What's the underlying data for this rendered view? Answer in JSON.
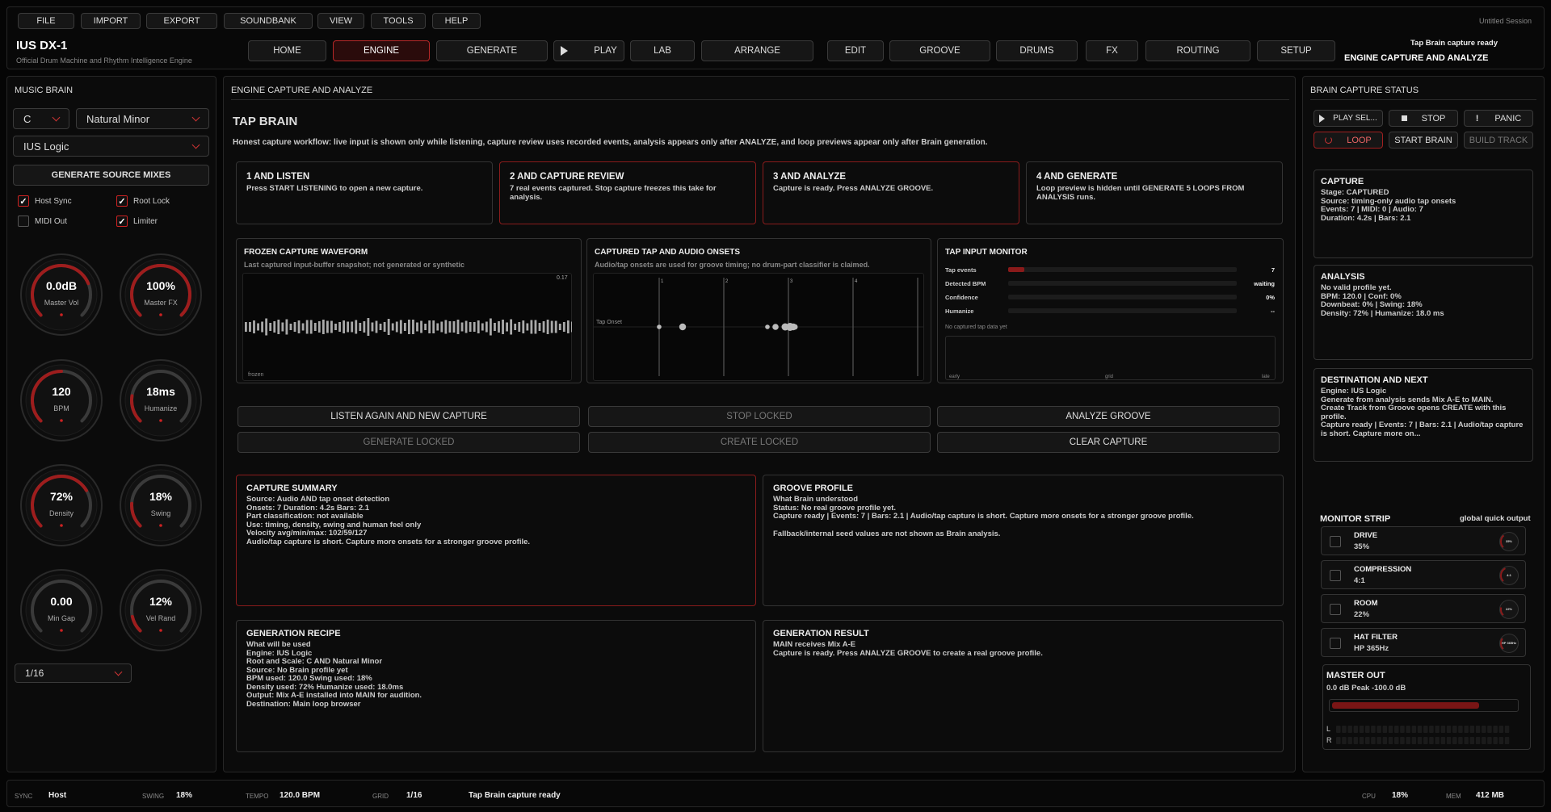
{
  "menu": [
    "FILE",
    "IMPORT",
    "EXPORT",
    "SOUNDBANK",
    "VIEW",
    "TOOLS",
    "HELP"
  ],
  "session": "Untitled Session",
  "app": {
    "title": "IUS DX-1",
    "subtitle": "Official Drum Machine and Rhythm Intelligence Engine"
  },
  "nav": [
    "HOME",
    "ENGINE",
    "GENERATE",
    "PLAY",
    "LAB",
    "ARRANGE",
    "EDIT",
    "GROOVE",
    "DRUMS",
    "FX",
    "ROUTING",
    "SETUP"
  ],
  "header": {
    "status": "Tap Brain capture ready",
    "mode": "ENGINE CAPTURE AND ANALYZE"
  },
  "left": {
    "title": "MUSIC BRAIN",
    "key": "C",
    "scale": "Natural Minor",
    "logic": "IUS Logic",
    "gen_btn": "GENERATE SOURCE MIXES",
    "checks": [
      {
        "label": "Host Sync",
        "on": true
      },
      {
        "label": "Root Lock",
        "on": true
      },
      {
        "label": "MIDI Out",
        "on": false
      },
      {
        "label": "Limiter",
        "on": true
      }
    ],
    "knobs": [
      {
        "value": "0.0dB",
        "label": "Master Vol",
        "level": 0.75
      },
      {
        "value": "100%",
        "label": "Master FX",
        "level": 1.0
      },
      {
        "value": "120",
        "label": "BPM",
        "level": 0.5
      },
      {
        "value": "18ms",
        "label": "Humanize",
        "level": 0.2
      },
      {
        "value": "72%",
        "label": "Density",
        "level": 0.72
      },
      {
        "value": "18%",
        "label": "Swing",
        "level": 0.18
      },
      {
        "value": "0.00",
        "label": "Min Gap",
        "level": 0.0
      },
      {
        "value": "12%",
        "label": "Vel Rand",
        "level": 0.12
      }
    ],
    "grid": "1/16"
  },
  "center": {
    "title": "ENGINE CAPTURE AND ANALYZE",
    "section": "TAP BRAIN",
    "workflow": "Honest capture workflow: live input is shown only while listening, capture review uses recorded events, analysis appears only after ANALYZE, and loop previews appear only after Brain generation.",
    "steps": [
      {
        "title": "1 AND LISTEN",
        "text": "Press START LISTENING to open a new capture."
      },
      {
        "title": "2 AND CAPTURE REVIEW",
        "text": "7 real events captured. Stop capture freezes this take for analysis."
      },
      {
        "title": "3 AND ANALYZE",
        "text": "Capture is ready. Press ANALYZE GROOVE."
      },
      {
        "title": "4 AND GENERATE",
        "text": "Loop preview is hidden until GENERATE 5 LOOPS FROM ANALYSIS runs."
      }
    ],
    "waveform": {
      "title": "FROZEN CAPTURE WAVEFORM",
      "sub": "Last captured input-buffer snapshot; not generated or synthetic",
      "peak": "0.17",
      "tag": "frozen"
    },
    "onsets": {
      "title": "CAPTURED TAP AND AUDIO ONSETS",
      "sub": "Audio/tap onsets are used for groove timing; no drum-part classifier is claimed.",
      "lane": "Tap Onset",
      "beats": [
        "1",
        "2",
        "3",
        "4"
      ]
    },
    "monitor": {
      "title": "TAP INPUT MONITOR",
      "rows": [
        {
          "label": "Tap events",
          "value": "7",
          "level": 0.07
        },
        {
          "label": "Detected BPM",
          "value": "waiting",
          "level": 0
        },
        {
          "label": "Confidence",
          "value": "0%",
          "level": 0
        },
        {
          "label": "Humanize",
          "value": "--",
          "level": 0
        }
      ],
      "empty": "No captured tap data yet",
      "axis": [
        "early",
        "grid",
        "late"
      ]
    },
    "actions": [
      "LISTEN AGAIN AND NEW CAPTURE",
      "STOP LOCKED",
      "ANALYZE GROOVE",
      "GENERATE LOCKED",
      "CREATE LOCKED",
      "CLEAR CAPTURE"
    ],
    "summary": {
      "title": "CAPTURE SUMMARY",
      "lines": [
        "Source: Audio AND tap onset detection",
        "Onsets: 7    Duration: 4.2s    Bars: 2.1",
        "Part classification: not available",
        "Use: timing, density, swing and human feel only",
        "Velocity avg/min/max: 102/59/127",
        "Audio/tap capture is short. Capture more onsets for a stronger groove profile."
      ]
    },
    "groove": {
      "title": "GROOVE PROFILE",
      "lines": [
        "What Brain understood",
        "Status: No real groove profile yet.",
        "Capture ready | Events: 7 | Bars: 2.1 | Audio/tap capture is short. Capture more onsets for a stronger groove profile.",
        "",
        "Fallback/internal seed values are not shown as Brain analysis."
      ]
    },
    "recipe": {
      "title": "GENERATION RECIPE",
      "lines": [
        "What will be used",
        "Engine: IUS Logic",
        "Root and Scale: C AND Natural Minor",
        "Source: No Brain profile yet",
        "BPM used: 120.0    Swing used: 18%",
        "Density used: 72%    Humanize used: 18.0ms",
        "Output: Mix A-E installed into MAIN for audition.",
        "Destination: Main loop browser"
      ]
    },
    "result": {
      "title": "GENERATION RESULT",
      "lines": [
        "MAIN receives Mix A-E",
        "Capture is ready. Press ANALYZE GROOVE to create a real groove profile."
      ]
    }
  },
  "right": {
    "title": "BRAIN CAPTURE STATUS",
    "transport": [
      "PLAY SEL...",
      "STOP",
      "PANIC",
      "LOOP",
      "START BRAIN",
      "BUILD TRACK"
    ],
    "capture": {
      "title": "CAPTURE",
      "lines": [
        "Stage: CAPTURED",
        "Source: timing-only audio tap onsets",
        "Events: 7 | MIDI: 0 | Audio: 7",
        "Duration: 4.2s | Bars: 2.1"
      ]
    },
    "analysis": {
      "title": "ANALYSIS",
      "lines": [
        "No valid profile yet.",
        "BPM: 120.0 | Conf: 0%",
        "Downbeat: 0% | Swing: 18%",
        "Density: 72% | Humanize: 18.0 ms"
      ]
    },
    "dest": {
      "title": "DESTINATION AND NEXT",
      "lines": [
        "Engine: IUS Logic",
        "Generate from analysis sends Mix A-E to MAIN.",
        "Create Track from Groove opens CREATE with this profile.",
        "Capture ready | Events: 7 | Bars: 2.1 | Audio/tap capture is short. Capture more on..."
      ]
    },
    "strip": {
      "title": "MONITOR STRIP",
      "sub": "global quick output",
      "rows": [
        {
          "name": "DRIVE",
          "value": "35%",
          "knob": "35%",
          "level": 0.35
        },
        {
          "name": "COMPRESSION",
          "value": "4:1",
          "knob": "4:1",
          "level": 0.4
        },
        {
          "name": "ROOM",
          "value": "22%",
          "knob": "22%",
          "level": 0.22
        },
        {
          "name": "HAT FILTER",
          "value": "HP 365Hz",
          "knob": "HP 365Hz",
          "level": 0.3
        }
      ]
    },
    "master": {
      "title": "MASTER OUT",
      "line": "0.0 dB   Peak -100.0 dB",
      "level": 0.8,
      "ch": [
        "L",
        "R"
      ]
    }
  },
  "status": [
    {
      "k": "SYNC",
      "v": "Host"
    },
    {
      "k": "SWING",
      "v": "18%"
    },
    {
      "k": "TEMPO",
      "v": "120.0 BPM"
    },
    {
      "k": "GRID",
      "v": "1/16"
    },
    {
      "k": "",
      "v": "Tap Brain capture ready"
    },
    {
      "k": "CPU",
      "v": "18%"
    },
    {
      "k": "MEM",
      "v": "412 MB"
    }
  ],
  "colors": {
    "accent": "#b82828",
    "bg": "#050505",
    "panel": "#0b0b0b"
  }
}
